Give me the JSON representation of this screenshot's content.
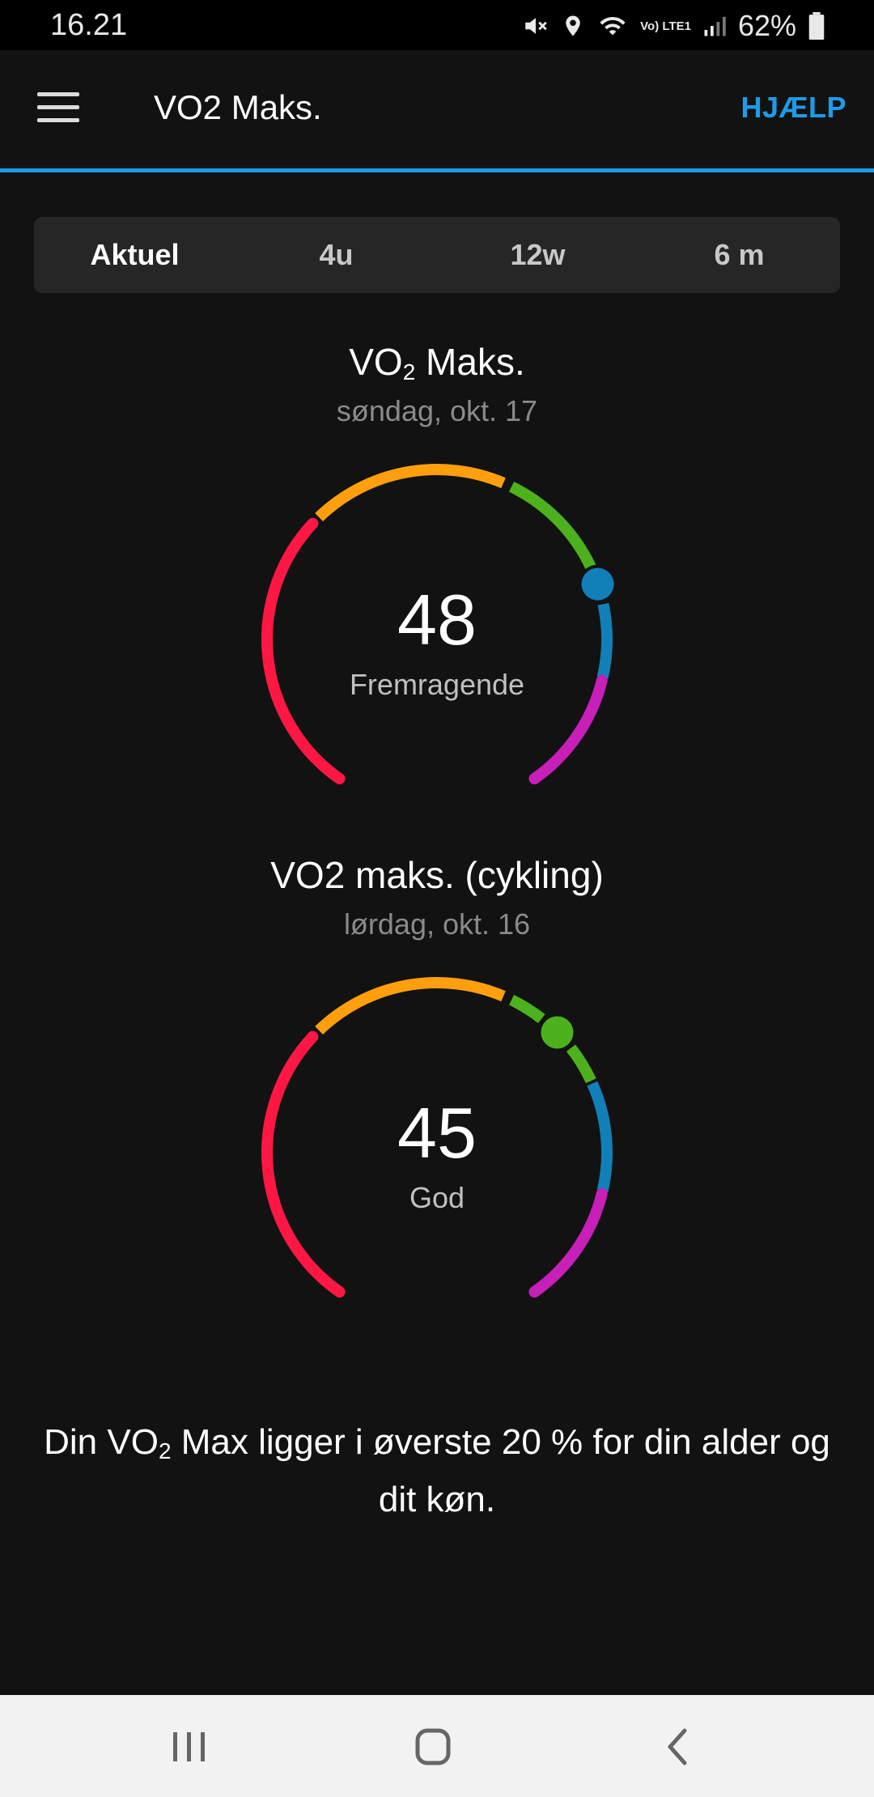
{
  "status_bar": {
    "time": "16.21",
    "battery": "62%",
    "network_label": "Vo) LTE1",
    "icons": [
      "mute-icon",
      "location-icon",
      "wifi-icon",
      "volte-icon",
      "signal-icon",
      "battery-icon"
    ]
  },
  "app_bar": {
    "title": "VO2 Maks.",
    "help_label": "HJÆLP",
    "accent_color": "#1e9be6"
  },
  "tabs": [
    {
      "label": "Aktuel",
      "active": true
    },
    {
      "label": "4u",
      "active": false
    },
    {
      "label": "12w",
      "active": false
    },
    {
      "label": "6 m",
      "active": false
    }
  ],
  "gauges": [
    {
      "title_prefix": "VO",
      "title_sub": "2",
      "title_suffix": " Maks.",
      "date": "søndag, okt. 17",
      "value": "48",
      "label": "Fremragende",
      "marker_zone": "blue"
    },
    {
      "title": "VO2 maks. (cykling)",
      "date": "lørdag, okt. 16",
      "value": "45",
      "label": "God",
      "marker_zone": "green"
    }
  ],
  "zone_colors": {
    "red": "#ff1744",
    "orange": "#ff9f0e",
    "green": "#4cb11d",
    "blue": "#1180b8",
    "purple": "#c71fb8"
  },
  "summary": {
    "prefix": "Din VO",
    "sub": "2",
    "suffix": " Max ligger i øverste 20 % for din alder og dit køn."
  },
  "nav_bar": {
    "buttons": [
      "recent-apps-icon",
      "home-icon",
      "back-icon"
    ]
  }
}
